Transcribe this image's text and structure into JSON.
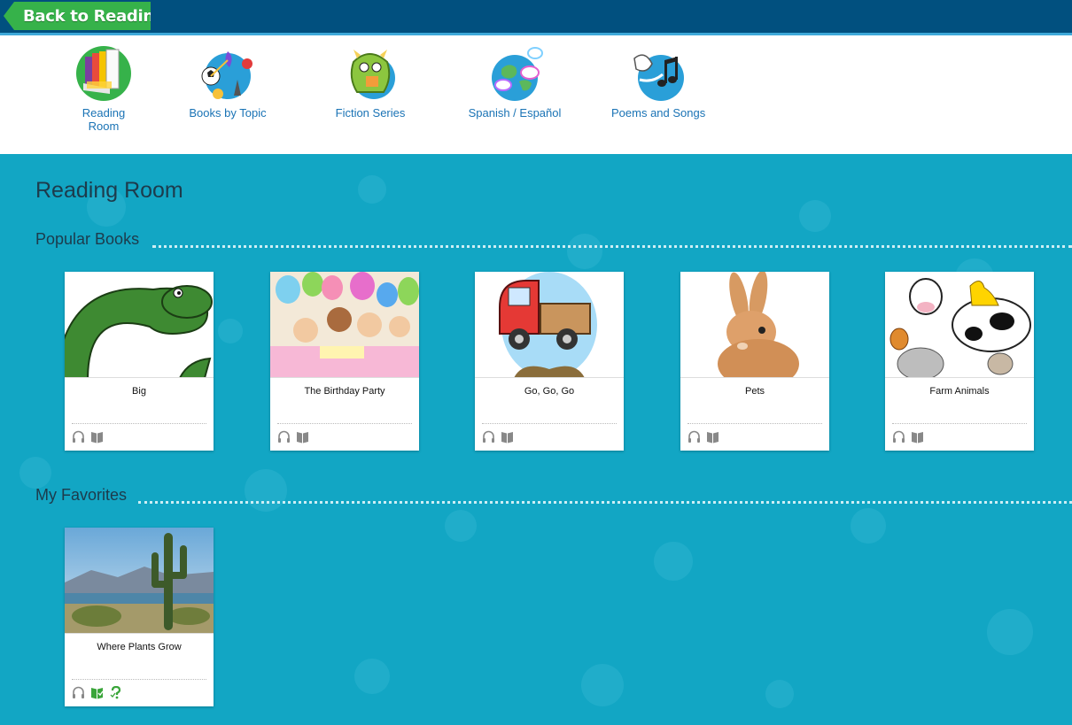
{
  "topbar": {
    "back_label": "Back to Reading"
  },
  "nav": {
    "items": [
      {
        "label": "Reading Room",
        "icon": "books-icon"
      },
      {
        "label": "Books by Topic",
        "icon": "topics-icon"
      },
      {
        "label": "Fiction Series",
        "icon": "monster-icon"
      },
      {
        "label": "Spanish / Español",
        "icon": "globe-icon"
      },
      {
        "label": "Poems and Songs",
        "icon": "music-note-icon"
      }
    ]
  },
  "main": {
    "title": "Reading Room",
    "popular": {
      "heading": "Popular Books",
      "books": [
        {
          "title": "Big"
        },
        {
          "title": "The Birthday Party"
        },
        {
          "title": "Go, Go, Go"
        },
        {
          "title": "Pets"
        },
        {
          "title": "Farm Animals"
        }
      ]
    },
    "favorites": {
      "heading": "My Favorites",
      "books": [
        {
          "title": "Where Plants Grow"
        }
      ]
    }
  },
  "colors": {
    "topbar": "#01507f",
    "back_button": "#36b24a",
    "background": "#12a6c4",
    "nav_label": "#1a73b5",
    "heading": "#1d3b4c"
  }
}
